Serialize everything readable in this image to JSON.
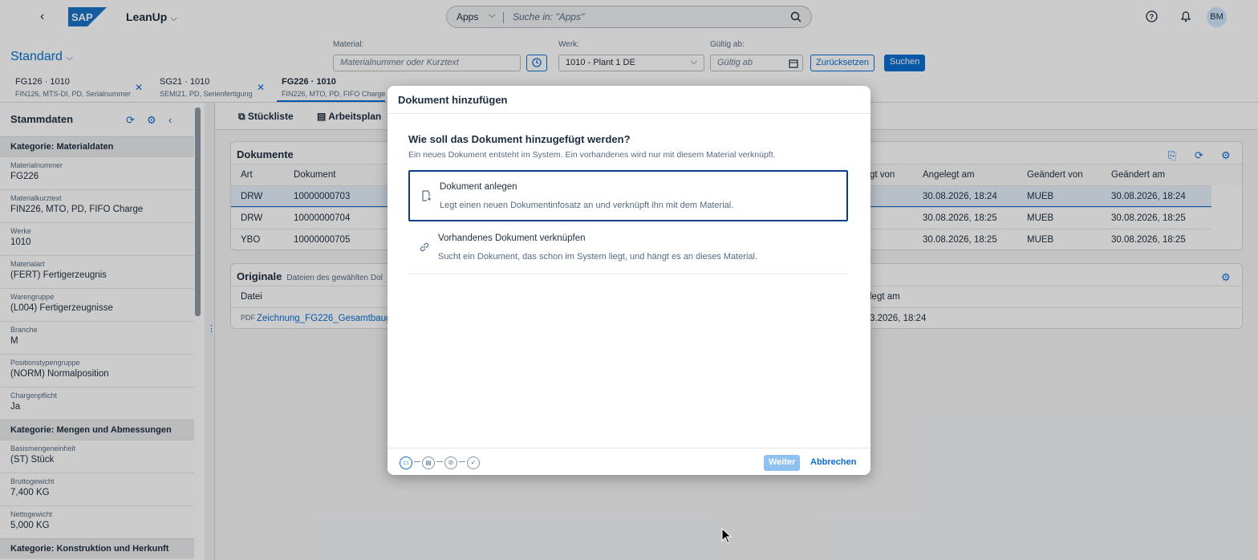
{
  "shell": {
    "app_title": "LeanUp",
    "search_scope": "Apps",
    "search_placeholder": "Suche in: \"Apps\"",
    "avatar_initials": "BM",
    "logo_text": "SAP"
  },
  "filter": {
    "variant": "Standard",
    "material_label": "Material:",
    "material_placeholder": "Materialnummer oder Kurztext",
    "werk_label": "Werk:",
    "werk_value": "1010 - Plant 1 DE",
    "gueltig_label": "Gültig ab:",
    "gueltig_placeholder": "Gültig ab",
    "reset_label": "Zurücksetzen",
    "search_label": "Suchen"
  },
  "tabs": [
    {
      "title": "FG126 · 1010",
      "sub": "FIN126, MTS-DI, PD, Serialnummer"
    },
    {
      "title": "SG21 · 1010",
      "sub": "SEMI21, PD, Serienfertigung"
    },
    {
      "title": "FG226 · 1010",
      "sub": "FIN226, MTO, PD, FIFO Charge"
    }
  ],
  "left": {
    "title": "Stammdaten",
    "cat1": "Kategorie: Materialdaten",
    "fields1": [
      {
        "label": "Materialnummer",
        "value": "FG226"
      },
      {
        "label": "Materialkurztext",
        "value": "FIN226, MTO, PD, FIFO Charge"
      },
      {
        "label": "Werke",
        "value": "1010"
      },
      {
        "label": "Materialart",
        "value": "(FERT) Fertigerzeugnis"
      },
      {
        "label": "Warengruppe",
        "value": "(L004) Fertigerzeugnisse"
      },
      {
        "label": "Branche",
        "value": "M"
      },
      {
        "label": "Positionstypengruppe",
        "value": "(NORM) Normalposition"
      },
      {
        "label": "Chargenpflicht",
        "value": "Ja"
      }
    ],
    "cat2": "Kategorie: Mengen und Abmessungen",
    "fields2": [
      {
        "label": "Basismengeneinheit",
        "value": "(ST) Stück"
      },
      {
        "label": "Bruttogewicht",
        "value": "7,400 KG"
      },
      {
        "label": "Nettogewicht",
        "value": "5,000 KG"
      }
    ],
    "cat3": "Kategorie: Konstruktion und Herkunft"
  },
  "main": {
    "tab_stueckliste": "Stückliste",
    "tab_arbeitsplan": "Arbeitsplan",
    "dokumente_title": "Dokumente",
    "doc_headers": [
      "Art",
      "Dokument",
      "gt von",
      "Angelegt am",
      "Geändert von",
      "Geändert am"
    ],
    "doc_rows": [
      [
        "DRW",
        "10000000703",
        "30.08.2026, 18:24",
        "MUEB",
        "30.08.2026, 18:24"
      ],
      [
        "DRW",
        "10000000704",
        "30.08.2026, 18:25",
        "MUEB",
        "30.08.2026, 18:25"
      ],
      [
        "YBO",
        "10000000705",
        "30.08.2026, 18:25",
        "MUEB",
        "30.08.2026, 18:25"
      ]
    ],
    "originale_title": "Originale",
    "originale_sub": "Dateien des gewählten Dol",
    "orig_header_datei": "Datei",
    "orig_header_angelegt": "legt am",
    "orig_file": "Zeichnung_FG226_Gesamtbaug",
    "orig_date": "3.2026, 18:24"
  },
  "dialog": {
    "title": "Dokument hinzufügen",
    "question": "Wie soll das Dokument hinzugefügt werden?",
    "question_sub": "Ein neues Dokument entsteht im System. Ein vorhandenes wird nur mit diesem Material verknüpft.",
    "opt1_title": "Dokument anlegen",
    "opt1_desc": "Legt einen neuen Dokumentinfosatz an und verknüpft ihn mit dem Material.",
    "opt2_title": "Vorhandenes Dokument verknüpfen",
    "opt2_desc": "Sucht ein Dokument, das schon im System liegt, und hängt es an dieses Material.",
    "next_label": "Weiter",
    "cancel_label": "Abbrechen"
  }
}
